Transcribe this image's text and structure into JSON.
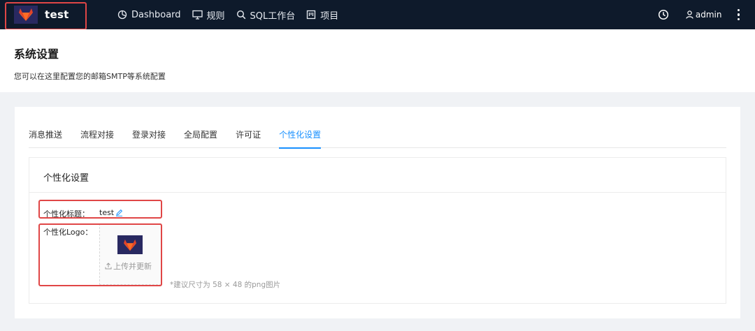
{
  "navbar": {
    "brand_name": "test",
    "nav": [
      {
        "label": "Dashboard",
        "icon": "dashboard-icon"
      },
      {
        "label": "规则",
        "icon": "monitor-icon"
      },
      {
        "label": "SQL工作台",
        "icon": "search-icon"
      },
      {
        "label": "项目",
        "icon": "project-icon"
      }
    ],
    "user": "admin"
  },
  "page": {
    "title": "系统设置",
    "description": "您可以在这里配置您的邮箱SMTP等系统配置"
  },
  "tabs": [
    "消息推送",
    "流程对接",
    "登录对接",
    "全局配置",
    "许可证",
    "个性化设置"
  ],
  "active_tab": "个性化设置",
  "panel": {
    "title": "个性化设置",
    "title_label": "个性化标题：",
    "title_value": "test",
    "logo_label": "个性化Logo：",
    "upload_label": "上传并更新",
    "hint": "*建议尺寸为 58 × 48 的png图片"
  },
  "colors": {
    "navbar_bg": "#0e1a2b",
    "accent": "#1890ff",
    "highlight": "#e04646",
    "logo_bg": "#292961"
  }
}
